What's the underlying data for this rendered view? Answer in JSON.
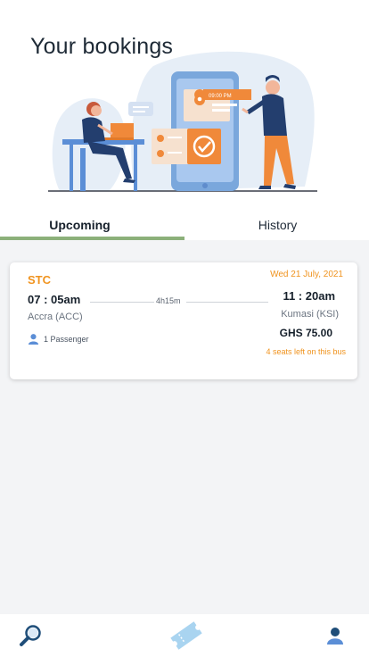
{
  "header": {
    "title": "Your bookings"
  },
  "tabs": [
    {
      "label": "Upcoming",
      "active": true
    },
    {
      "label": "History",
      "active": false
    }
  ],
  "illustration": {
    "phone_time_label": "09:00 PM"
  },
  "booking": {
    "operator": "STC",
    "date": "Wed 21 July, 2021",
    "departure_time": "07 : 05am",
    "arrival_time": "11 : 20am",
    "duration": "4h15m",
    "departure_city": "Accra (ACC)",
    "arrival_city": "Kumasi (KSI)",
    "passengers": "1 Passenger",
    "price": "GHS 75.00",
    "seats_left": "4 seats left on this bus"
  },
  "nav": {
    "items": [
      {
        "icon": "search-icon"
      },
      {
        "icon": "ticket-icon",
        "active": true
      },
      {
        "icon": "profile-icon"
      }
    ]
  },
  "colors": {
    "accent": "#f0931e",
    "tab_indicator": "#8cb07a",
    "nav_icon": "#1f4e79",
    "nav_icon_active": "#a9d4f0"
  }
}
